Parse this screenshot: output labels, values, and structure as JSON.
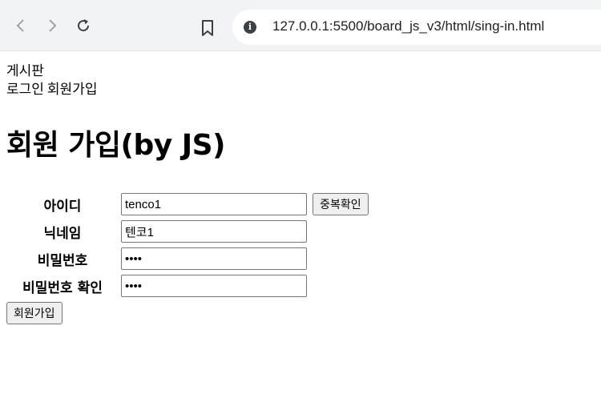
{
  "browser": {
    "url": "127.0.0.1:5500/board_js_v3/html/sing-in.html"
  },
  "header": {
    "site_title": "게시판",
    "nav": [
      "로그인",
      "회원가입"
    ]
  },
  "main": {
    "title": "회원 가입(by JS)",
    "form": {
      "username_label": "아이디",
      "username_value": "tenco1",
      "dup_check_label": "중복확인",
      "nickname_label": "닉네임",
      "nickname_value": "텐코1",
      "password_label": "비밀번호",
      "password_value": "1234",
      "password_confirm_label": "비밀번호 확인",
      "password_confirm_value": "1234",
      "submit_label": "회원가입"
    }
  },
  "icons": {
    "back": "back-arrow-icon",
    "forward": "forward-arrow-icon",
    "reload": "reload-icon",
    "bookmark": "bookmark-icon",
    "site_info": "info-icon"
  }
}
